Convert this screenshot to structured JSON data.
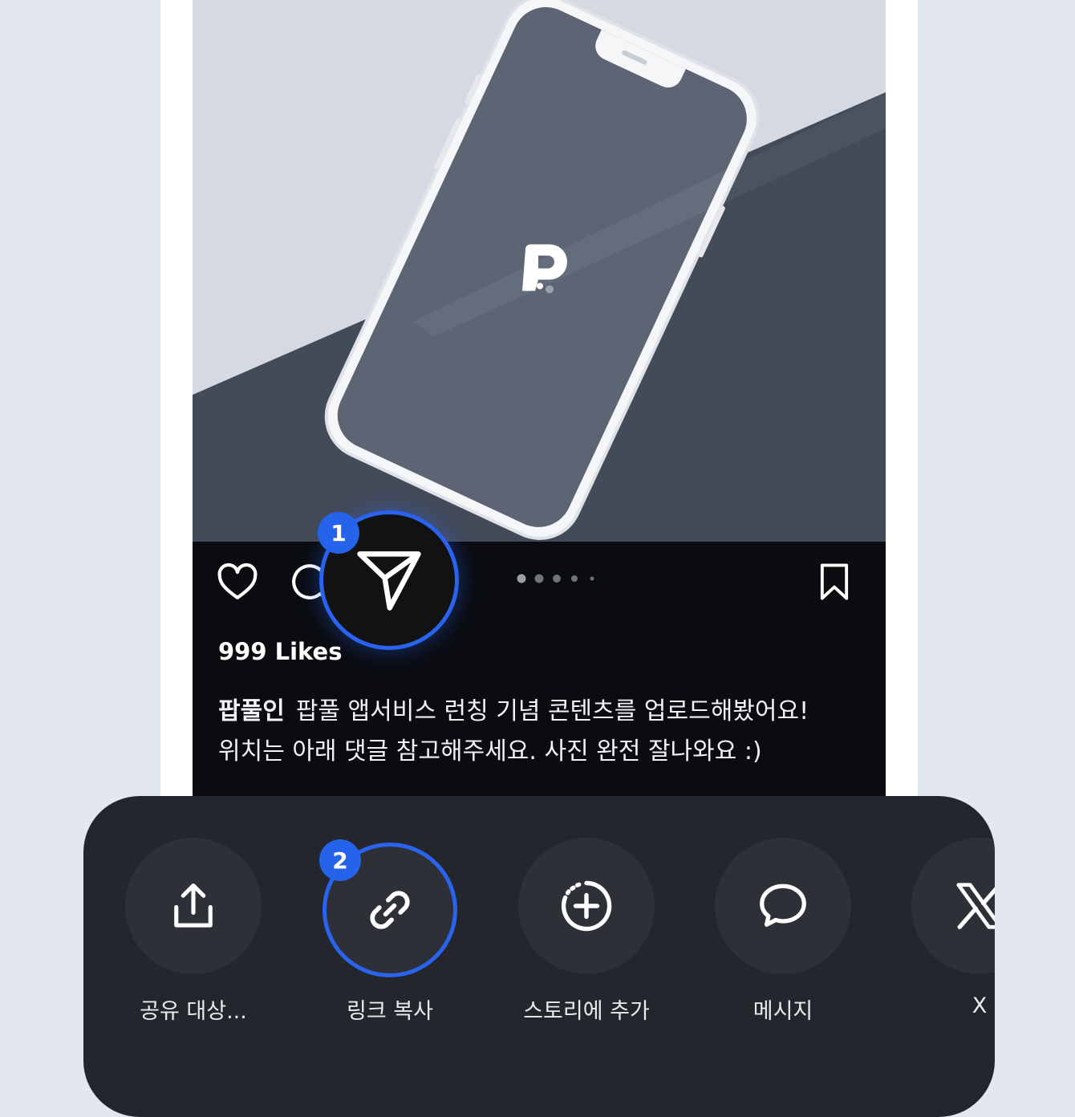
{
  "post": {
    "likes_text": "999 Likes",
    "username": "팝풀인",
    "caption_line1": "팝풀 앱서비스 런칭 기념 콘텐츠를 업로드해봤어요!",
    "caption_line2": "위치는 아래 댓글 참고해주세요. 사진 완전 잘나와요 :)",
    "carousel_dots": 5,
    "carousel_active_index": 0
  },
  "steps": {
    "step1": "1",
    "step2": "2"
  },
  "share_sheet": {
    "items": [
      {
        "label": "공유 대상...",
        "icon": "share-upload-icon"
      },
      {
        "label": "링크 복사",
        "icon": "link-icon"
      },
      {
        "label": "스토리에 추가",
        "icon": "story-add-icon"
      },
      {
        "label": "메시지",
        "icon": "chat-bubble-icon"
      },
      {
        "label": "X",
        "icon": "x-logo-icon"
      }
    ]
  },
  "colors": {
    "highlight": "#2b63f1",
    "badge": "#2563eb",
    "sheet_bg": "#23262c",
    "circle_bg": "#2d3037"
  }
}
